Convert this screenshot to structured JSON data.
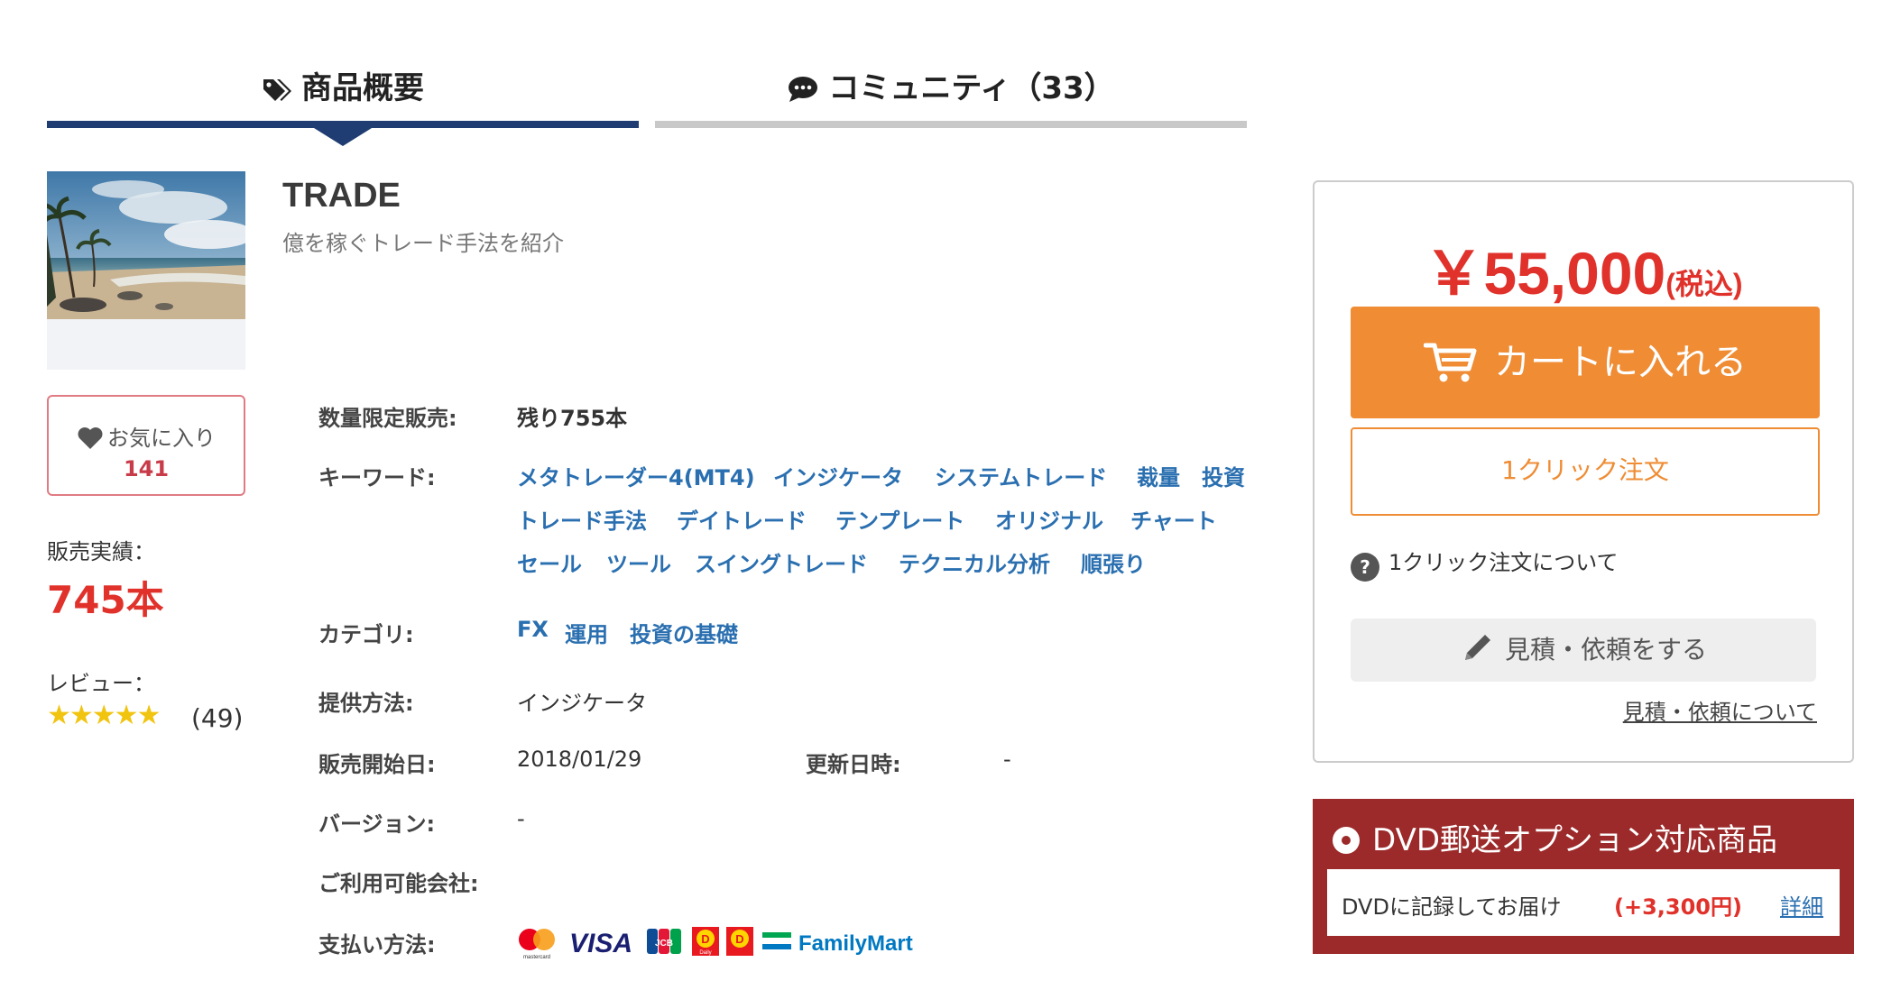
{
  "tabs": [
    {
      "label": "商品概要"
    },
    {
      "label": "コミュニティ（33）"
    }
  ],
  "product": {
    "title": "TRADE",
    "subtitle": "億を稼ぐトレード手法を紹介"
  },
  "favorite": {
    "label": "お気に入り",
    "count": "141"
  },
  "sales": {
    "label": "販売実績：",
    "value": "745本"
  },
  "review": {
    "label": "レビュー：",
    "stars": "★★★★★",
    "rating": 4.5,
    "count": "(49)"
  },
  "specs": {
    "limited_label": "数量限定販売:",
    "limited_value": "残り755本",
    "keywords_label": "キーワード:",
    "keywords": [
      "メタトレーダー4(MT4)",
      "インジケータ",
      "システムトレード",
      "裁量",
      "投資",
      "トレード手法",
      "デイトレード",
      "テンプレート",
      "オリジナル",
      "チャート",
      "セール",
      "ツール",
      "スイングトレード",
      "テクニカル分析",
      "順張り"
    ],
    "category_label": "カテゴリ:",
    "categories": [
      "FX",
      "運用",
      "投資の基礎"
    ],
    "delivery_label": "提供方法:",
    "delivery_value": "インジケータ",
    "start_label": "販売開始日:",
    "start_value": "2018/01/29",
    "updated_label": "更新日時:",
    "updated_value": "-",
    "version_label": "バージョン:",
    "version_value": "-",
    "company_label": "ご利用可能会社:",
    "payment_label": "支払い方法:",
    "payment_methods": [
      "mastercard",
      "VISA",
      "JCB",
      "Daily",
      "Yamazaki",
      "FamilyMart"
    ]
  },
  "buy": {
    "price": "￥55,000",
    "tax": "(税込)",
    "cart_button": "カートに入れる",
    "oneclick_button": "1クリック注文",
    "oneclick_help": "1クリック注文について",
    "quote_button": "見積・依頼をする",
    "quote_link": "見積・依頼について"
  },
  "dvd": {
    "title": "DVD郵送オプション対応商品",
    "text": "DVDに記録してお届け",
    "price": "(+3,300円)",
    "link": "詳細"
  },
  "colors": {
    "accent": "#ef8c34",
    "price": "#e0322b",
    "navy": "#1f3d72",
    "link": "#2a6fb0",
    "dvd": "#9c2a2a"
  }
}
